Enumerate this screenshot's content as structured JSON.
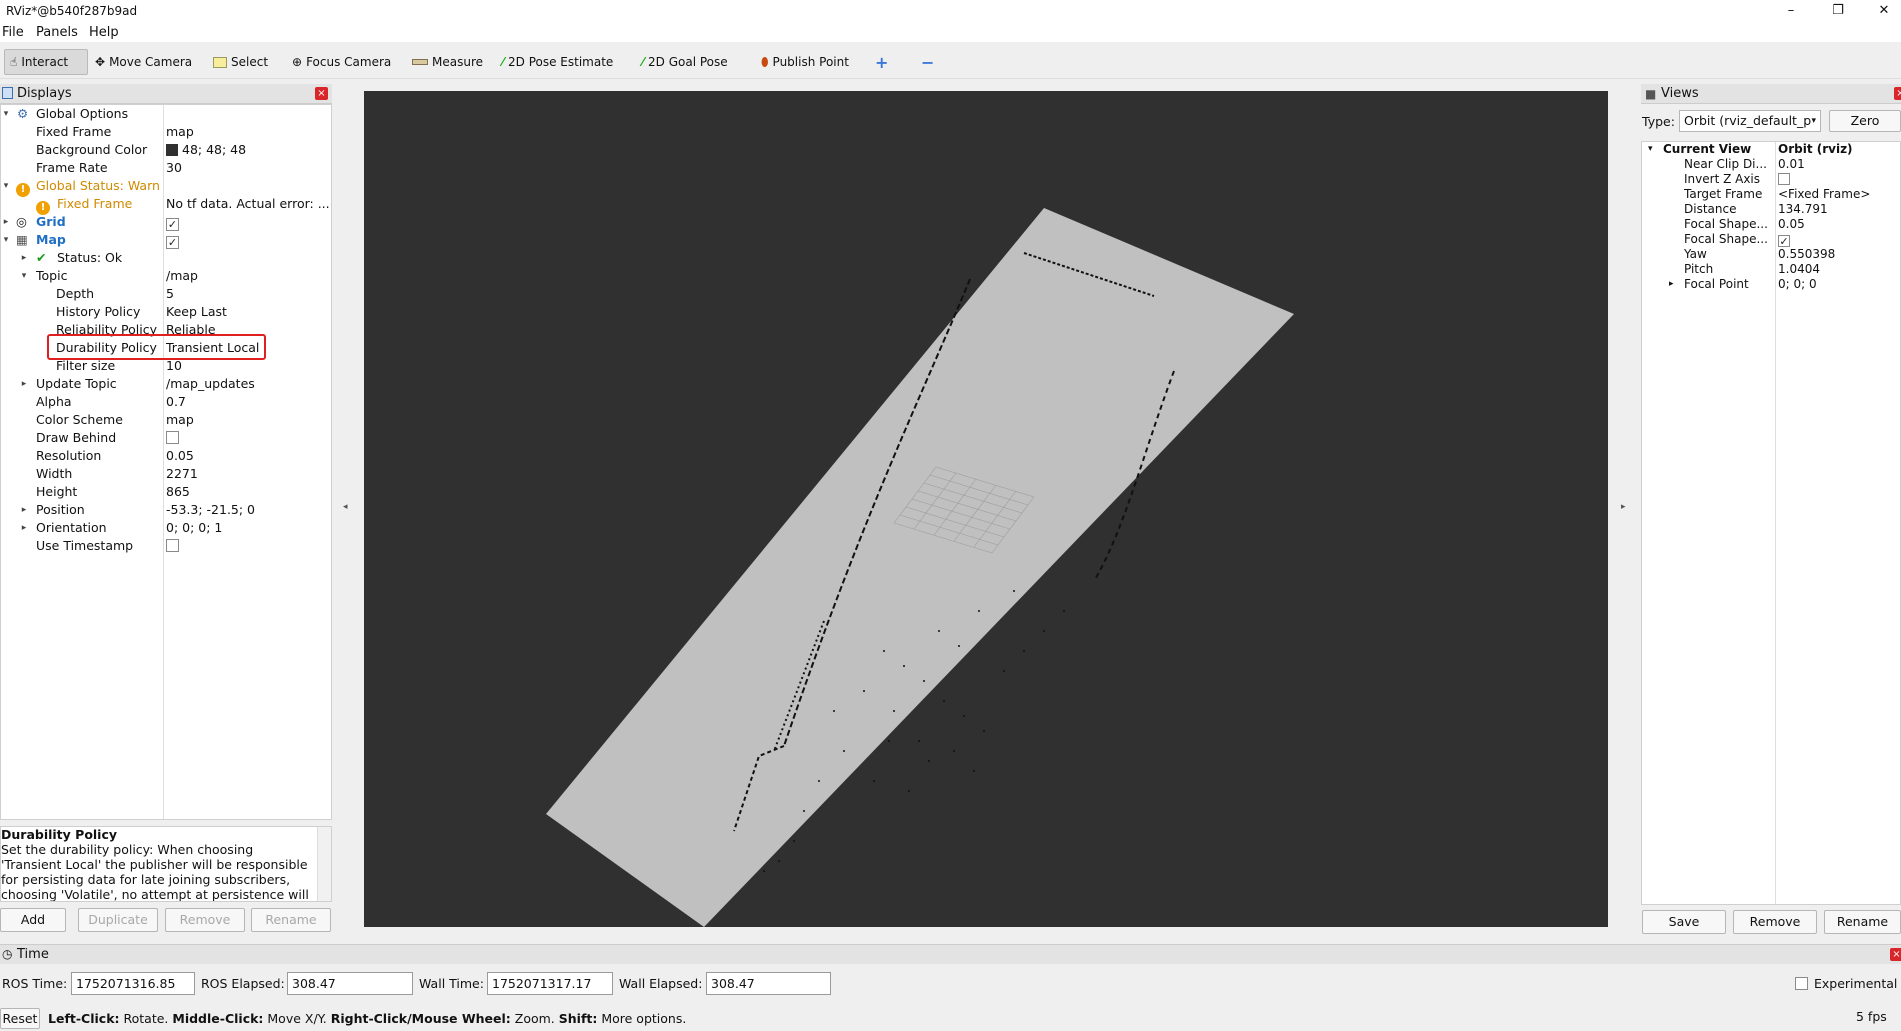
{
  "window": {
    "title": "RViz*@b540f287b9ad",
    "minimize": "–",
    "maximize": "❐",
    "close": "✕"
  },
  "menu": [
    "File",
    "Panels",
    "Help"
  ],
  "toolbar": {
    "tools": [
      {
        "label": "Interact",
        "icon": "hand-icon",
        "active": true
      },
      {
        "label": "Move Camera",
        "icon": "move-camera-icon"
      },
      {
        "label": "Select",
        "icon": "select-icon"
      },
      {
        "label": "Focus Camera",
        "icon": "focus-camera-icon"
      },
      {
        "label": "Measure",
        "icon": "ruler-icon"
      },
      {
        "label": "2D Pose Estimate",
        "icon": "green-arrow-icon"
      },
      {
        "label": "2D Goal Pose",
        "icon": "green-arrow-icon"
      },
      {
        "label": "Publish Point",
        "icon": "pin-icon"
      }
    ],
    "plus": "+",
    "minus": "−"
  },
  "displays": {
    "title": "Displays",
    "rows": [
      {
        "key": "Global Options",
        "val": ""
      },
      {
        "key": "Fixed Frame",
        "val": "map"
      },
      {
        "key": "Background Color",
        "val": "48; 48; 48"
      },
      {
        "key": "Frame Rate",
        "val": "30"
      },
      {
        "key": "Global Status: Warn",
        "val": ""
      },
      {
        "key": "Fixed Frame",
        "val": "No tf data.  Actual error: ..."
      },
      {
        "key": "Grid",
        "val": ""
      },
      {
        "key": "Map",
        "val": ""
      },
      {
        "key": "Status: Ok",
        "val": ""
      },
      {
        "key": "Topic",
        "val": "/map"
      },
      {
        "key": "Depth",
        "val": "5"
      },
      {
        "key": "History Policy",
        "val": "Keep Last"
      },
      {
        "key": "Reliability Policy",
        "val": "Reliable"
      },
      {
        "key": "Durability Policy",
        "val": "Transient Local"
      },
      {
        "key": "Filter size",
        "val": "10"
      },
      {
        "key": "Update Topic",
        "val": "/map_updates"
      },
      {
        "key": "Alpha",
        "val": "0.7"
      },
      {
        "key": "Color Scheme",
        "val": "map"
      },
      {
        "key": "Draw Behind",
        "val": ""
      },
      {
        "key": "Resolution",
        "val": "0.05"
      },
      {
        "key": "Width",
        "val": "2271"
      },
      {
        "key": "Height",
        "val": "865"
      },
      {
        "key": "Position",
        "val": "-53.3; -21.5; 0"
      },
      {
        "key": "Orientation",
        "val": "0; 0; 0; 1"
      },
      {
        "key": "Use Timestamp",
        "val": ""
      }
    ],
    "description_title": "Durability Policy",
    "description_body": "Set the durability policy: When choosing 'Transient Local' the publisher will be responsible for persisting data for late joining subscribers, choosing 'Volatile', no attempt at persistence will be made.",
    "buttons": {
      "add": "Add",
      "duplicate": "Duplicate",
      "remove": "Remove",
      "rename": "Rename"
    }
  },
  "views": {
    "title": "Views",
    "type_label": "Type:",
    "type_value": "Orbit (rviz_default_p",
    "zero": "Zero",
    "rows": [
      {
        "key": "Current View",
        "val": "Orbit (rviz)"
      },
      {
        "key": "Near Clip Di...",
        "val": "0.01"
      },
      {
        "key": "Invert Z Axis",
        "val": ""
      },
      {
        "key": "Target Frame",
        "val": "<Fixed Frame>"
      },
      {
        "key": "Distance",
        "val": "134.791"
      },
      {
        "key": "Focal Shape...",
        "val": "0.05"
      },
      {
        "key": "Focal Shape...",
        "val": ""
      },
      {
        "key": "Yaw",
        "val": "0.550398"
      },
      {
        "key": "Pitch",
        "val": "1.0404"
      },
      {
        "key": "Focal Point",
        "val": "0; 0; 0"
      }
    ],
    "buttons": {
      "save": "Save",
      "remove": "Remove",
      "rename": "Rename"
    }
  },
  "time": {
    "title": "Time",
    "ros_time_label": "ROS Time:",
    "ros_time": "1752071316.85",
    "ros_elapsed_label": "ROS Elapsed:",
    "ros_elapsed": "308.47",
    "wall_time_label": "Wall Time:",
    "wall_time": "1752071317.17",
    "wall_elapsed_label": "Wall Elapsed:",
    "wall_elapsed": "308.47",
    "experimental": "Experimental"
  },
  "status": {
    "reset": "Reset",
    "lc": "Left-Click:",
    "lc_t": " Rotate. ",
    "mc": "Middle-Click:",
    "mc_t": " Move X/Y. ",
    "rc": "Right-Click/Mouse Wheel:",
    "rc_t": " Zoom. ",
    "sh": "Shift:",
    "sh_t": " More options.",
    "fps": "5 fps"
  },
  "colors": {
    "viewport_bg": "#303030",
    "map_free": "#c0c0c0",
    "accent": "#1f6fc4",
    "warn": "#d08a00",
    "highlight": "#e02020"
  }
}
